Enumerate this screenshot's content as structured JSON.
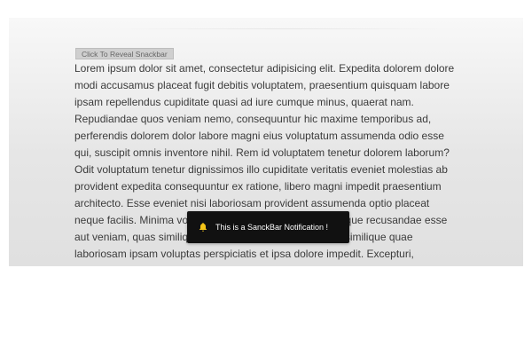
{
  "reveal_button": {
    "label": "Click To Reveal Snackbar"
  },
  "content": {
    "paragraph": "Lorem ipsum dolor sit amet, consectetur adipisicing elit. Expedita dolorem dolore modi accusamus placeat fugit debitis voluptatem, praesentium quisquam labore ipsam repellendus cupiditate quasi ad iure cumque minus, quaerat nam. Repudiandae quos veniam nemo, consequuntur hic maxime temporibus ad, perferendis dolorem dolor labore magni eius voluptatum assumenda odio esse qui, suscipit omnis inventore nihil. Rem id voluptatem tenetur dolorem laborum? Odit voluptatum tenetur dignissimos illo cupiditate veritatis eveniet molestias ab provident expedita consequuntur ex ratione, libero magni impedit praesentium architecto. Esse eveniet nisi laboriosam provident assumenda optio placeat neque facilis. Minima voluptates eos nulla optio ut nihil neque recusandae esse aut veniam, quas similique dolorum nam id impedit sequi similique quae laboriosam ipsam voluptas perspiciatis et ipsa dolore impedit. Excepturi, recusandae fuga? Cumque suscipit itaque sint, quod, minus amet, repudiandae consequatur repellendus at laudantium ut dolorem totam perferendis dolorum esse rem rerum."
  },
  "snackbar": {
    "icon": "bell-icon",
    "icon_color": "#f5c518",
    "background": "#111111",
    "message": "This is a SanckBar Notification !"
  }
}
